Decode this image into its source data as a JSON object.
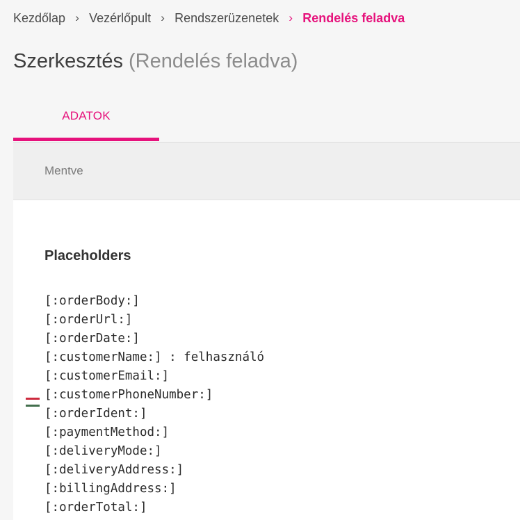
{
  "breadcrumb": {
    "items": [
      {
        "label": "Kezdőlap"
      },
      {
        "label": "Vezérlőpult"
      },
      {
        "label": "Rendszerüzenetek"
      }
    ],
    "current": "Rendelés feladva",
    "separator": "›"
  },
  "page": {
    "title": "Szerkesztés",
    "subtitle": "(Rendelés feladva)"
  },
  "tabs": [
    {
      "label": "ADATOK",
      "active": true
    }
  ],
  "status": {
    "text": "Mentve"
  },
  "placeholders": {
    "title": "Placeholders",
    "items": [
      "[:orderBody:]",
      "[:orderUrl:]",
      "[:orderDate:]",
      "[:customerName:] : felhasználó",
      "[:customerEmail:]",
      "[:customerPhoneNumber:]",
      "[:orderIdent:]",
      "[:paymentMethod:]",
      "[:deliveryMode:]",
      "[:deliveryAddress:]",
      "[:billingAddress:]",
      "[:orderTotal:]"
    ]
  },
  "language_flag": {
    "icon": "hungarian-flag-icon",
    "colors": [
      "#cd2a3e",
      "#ffffff",
      "#436f4d"
    ]
  },
  "colors": {
    "accent": "#e6127c"
  }
}
